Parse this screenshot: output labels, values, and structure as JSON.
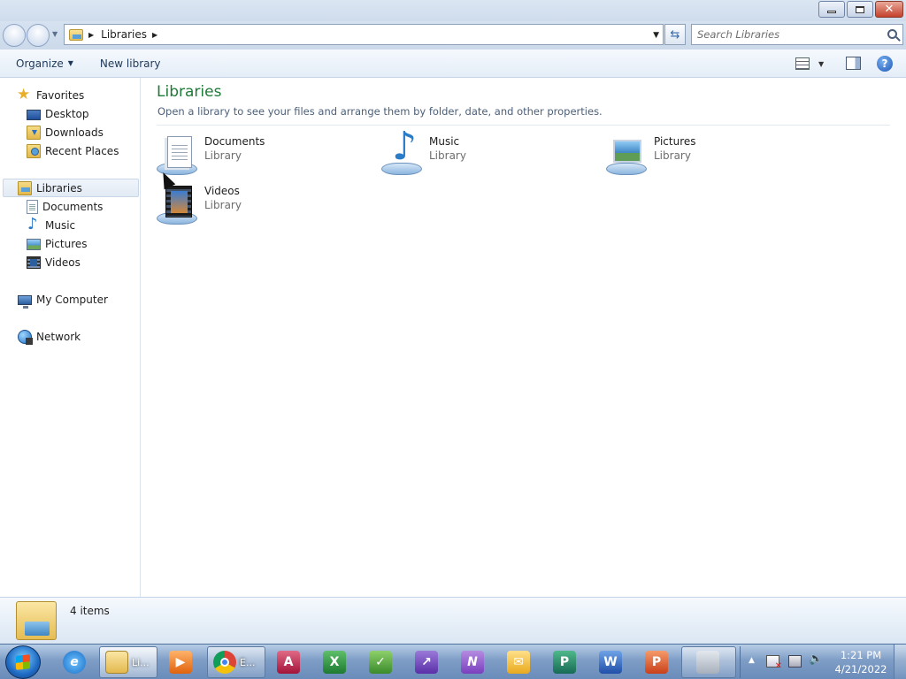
{
  "window": {
    "minimize_label": "",
    "maximize_label": "",
    "close_label": "✕"
  },
  "address": {
    "crumb": "Libraries",
    "search_placeholder": "Search Libraries"
  },
  "toolbar": {
    "organize_label": "Organize",
    "new_library_label": "New library",
    "help_label": "?"
  },
  "nav": {
    "favorites": "Favorites",
    "desktop": "Desktop",
    "downloads": "Downloads",
    "recent_places": "Recent Places",
    "libraries": "Libraries",
    "documents": "Documents",
    "music": "Music",
    "pictures": "Pictures",
    "videos": "Videos",
    "my_computer": "My Computer",
    "network": "Network"
  },
  "content": {
    "title": "Libraries",
    "subtitle": "Open a library to see your files and arrange them by folder, date, and other properties.",
    "libraries": [
      {
        "name": "Documents",
        "type": "Library",
        "icon": "documents-library-icon"
      },
      {
        "name": "Music",
        "type": "Library",
        "icon": "music-library-icon"
      },
      {
        "name": "Pictures",
        "type": "Library",
        "icon": "pictures-library-icon"
      },
      {
        "name": "Videos",
        "type": "Library",
        "icon": "videos-library-icon"
      }
    ]
  },
  "status": {
    "items_count": "4 items"
  },
  "taskbar": {
    "explorer_label": "Li...",
    "chrome_label": "E...",
    "apps": [
      "windows-explorer",
      "internet-explorer",
      "media-player",
      "chrome",
      "access",
      "excel",
      "infopath",
      "onenote-teams",
      "onenote",
      "outlook",
      "publisher",
      "word",
      "powerpoint",
      "network-drive"
    ],
    "time": "1:21 PM",
    "date": "4/21/2022"
  },
  "colors": {
    "title_green": "#1e7a37",
    "selection_blue": "#e2eaf4",
    "taskbar_blue": "#7e9dc6"
  }
}
